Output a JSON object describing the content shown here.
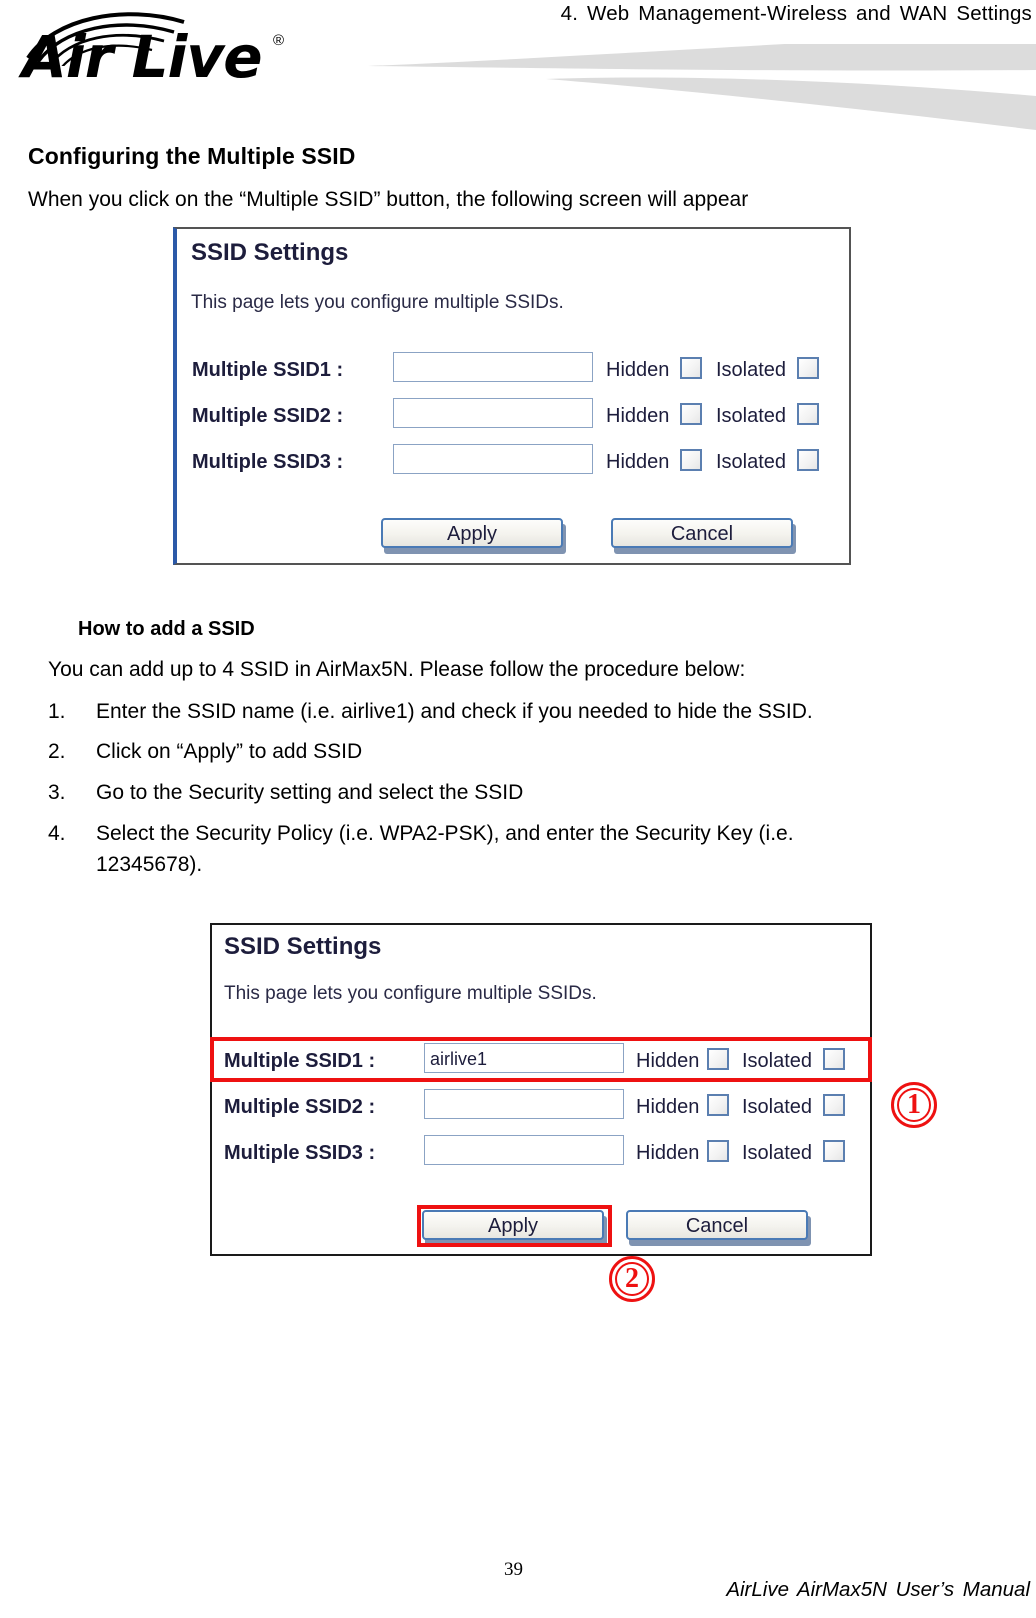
{
  "header": {
    "chapter": "4. Web Management-Wireless and WAN Settings",
    "logo_text": "Air Live",
    "logo_registered": "®",
    "logo_icon": "wifi-arcs-icon",
    "banner_icon": "swoosh-graphic"
  },
  "content": {
    "section_title": "Configuring the Multiple SSID",
    "intro": "When you click on the “Multiple SSID” button, the following screen will appear",
    "howto_title": "How to add a SSID",
    "howto_lead": "You can add up to 4 SSID in AirMax5N. Please follow the procedure below:",
    "steps": [
      {
        "num": "1.",
        "text": "Enter the SSID name (i.e. airlive1) and check if you needed to hide the SSID."
      },
      {
        "num": "2.",
        "text": "Click on “Apply” to add SSID"
      },
      {
        "num": "3.",
        "text": "Go to the Security setting and select the SSID"
      },
      {
        "num": "4.",
        "text": "Select the Security Policy (i.e. WPA2-PSK), and enter the Security Key (i.e.",
        "text2": "12345678)."
      }
    ]
  },
  "screenshot_one": {
    "title": "SSID Settings",
    "description": "This page lets you configure multiple SSIDs.",
    "rows": [
      {
        "label": "Multiple SSID1 :",
        "value": "",
        "hidden_label": "Hidden",
        "isolated_label": "Isolated"
      },
      {
        "label": "Multiple SSID2 :",
        "value": "",
        "hidden_label": "Hidden",
        "isolated_label": "Isolated"
      },
      {
        "label": "Multiple SSID3 :",
        "value": "",
        "hidden_label": "Hidden",
        "isolated_label": "Isolated"
      }
    ],
    "apply_label": "Apply",
    "cancel_label": "Cancel"
  },
  "screenshot_two": {
    "title": "SSID Settings",
    "description": "This page lets you configure multiple SSIDs.",
    "rows": [
      {
        "label": "Multiple SSID1 :",
        "value": "airlive1",
        "hidden_label": "Hidden",
        "isolated_label": "Isolated"
      },
      {
        "label": "Multiple SSID2 :",
        "value": "",
        "hidden_label": "Hidden",
        "isolated_label": "Isolated"
      },
      {
        "label": "Multiple SSID3 :",
        "value": "",
        "hidden_label": "Hidden",
        "isolated_label": "Isolated"
      }
    ],
    "apply_label": "Apply",
    "cancel_label": "Cancel",
    "annotations": {
      "marker_one": "①",
      "marker_one_digit": "1",
      "marker_two": "②",
      "marker_two_digit": "2",
      "highlight_color": "#ee1111"
    }
  },
  "footer": {
    "page_number": "39",
    "manual": "AirLive AirMax5N User’s Manual"
  }
}
